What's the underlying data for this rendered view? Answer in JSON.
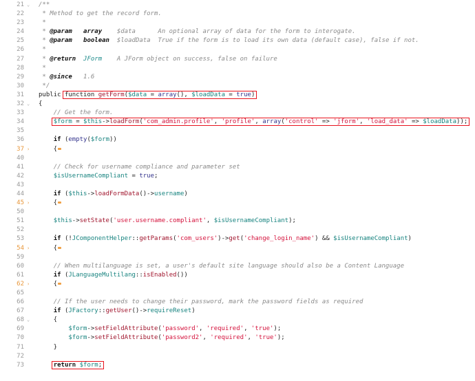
{
  "watermark": "FREEBUF",
  "colors": {
    "highlight_box": "#e8121c",
    "collapsed_fold": "#e8973a",
    "variable": "#17837f",
    "function": "#a0142c",
    "string": "#d4113b",
    "builtin": "#33338c",
    "comment": "#8a8a8a"
  },
  "lines": [
    {
      "n": "21",
      "fold": "open",
      "t": [
        [
          "c",
          "/**"
        ]
      ]
    },
    {
      "n": "22",
      "t": [
        [
          "c",
          " * Method to get the record form."
        ]
      ]
    },
    {
      "n": "23",
      "t": [
        [
          "c",
          " *"
        ]
      ]
    },
    {
      "n": "24",
      "t": [
        [
          "c",
          " * "
        ],
        [
          "t",
          "@param"
        ],
        [
          "c",
          "   "
        ],
        [
          "t",
          "array"
        ],
        [
          "c",
          "    $data      An optional array of data for the form to interogate."
        ]
      ]
    },
    {
      "n": "25",
      "t": [
        [
          "c",
          " * "
        ],
        [
          "t",
          "@param"
        ],
        [
          "c",
          "   "
        ],
        [
          "t",
          "boolean"
        ],
        [
          "c",
          "  $loadData  True if the form is to load its own data (default case), false if not."
        ]
      ]
    },
    {
      "n": "26",
      "t": [
        [
          "c",
          " *"
        ]
      ]
    },
    {
      "n": "27",
      "t": [
        [
          "c",
          " * "
        ],
        [
          "t",
          "@return"
        ],
        [
          "c",
          "  "
        ],
        [
          "jf",
          "JForm"
        ],
        [
          "c",
          "    A JForm object on success, false on failure"
        ]
      ]
    },
    {
      "n": "28",
      "t": [
        [
          "c",
          " *"
        ]
      ]
    },
    {
      "n": "29",
      "t": [
        [
          "c",
          " * "
        ],
        [
          "t",
          "@since"
        ],
        [
          "c",
          "   1.6"
        ]
      ]
    },
    {
      "n": "30",
      "t": [
        [
          "c",
          " */"
        ]
      ]
    },
    {
      "n": "31",
      "box_from": 1,
      "t": [
        [
          "p",
          "public "
        ],
        [
          "p",
          "function "
        ],
        [
          "f",
          "getForm"
        ],
        [
          "p",
          "("
        ],
        [
          "v",
          "$data"
        ],
        [
          "p",
          " = "
        ],
        [
          "b",
          "array"
        ],
        [
          "p",
          "(), "
        ],
        [
          "v",
          "$loadData"
        ],
        [
          "p",
          " = "
        ],
        [
          "b",
          "true"
        ],
        [
          "p",
          ")"
        ]
      ]
    },
    {
      "n": "32",
      "fold": "open",
      "t": [
        [
          "p",
          "{"
        ]
      ]
    },
    {
      "n": "33",
      "t": [
        [
          "p",
          "    "
        ],
        [
          "c",
          "// Get the form."
        ]
      ]
    },
    {
      "n": "34",
      "box_from": 1,
      "t": [
        [
          "p",
          "    "
        ],
        [
          "v",
          "$form"
        ],
        [
          "p",
          " = "
        ],
        [
          "v",
          "$this"
        ],
        [
          "p",
          "->"
        ],
        [
          "f",
          "loadForm"
        ],
        [
          "p",
          "("
        ],
        [
          "s",
          "'com_admin.profile'"
        ],
        [
          "p",
          ", "
        ],
        [
          "s",
          "'profile'"
        ],
        [
          "p",
          ", "
        ],
        [
          "b",
          "array"
        ],
        [
          "p",
          "("
        ],
        [
          "s",
          "'control'"
        ],
        [
          "p",
          " => "
        ],
        [
          "s",
          "'jform'"
        ],
        [
          "p",
          ", "
        ],
        [
          "s",
          "'load_data'"
        ],
        [
          "p",
          " => "
        ],
        [
          "v",
          "$loadData"
        ],
        [
          "p",
          "));"
        ]
      ]
    },
    {
      "n": "35",
      "t": []
    },
    {
      "n": "36",
      "t": [
        [
          "p",
          "    "
        ],
        [
          "k",
          "if"
        ],
        [
          "p",
          " ("
        ],
        [
          "b",
          "empty"
        ],
        [
          "p",
          "("
        ],
        [
          "v",
          "$form"
        ],
        [
          "p",
          "))"
        ]
      ]
    },
    {
      "n": "37",
      "fold": "closed",
      "t": [
        [
          "p",
          "    {"
        ]
      ]
    },
    {
      "n": "40",
      "t": []
    },
    {
      "n": "41",
      "t": [
        [
          "p",
          "    "
        ],
        [
          "c",
          "// Check for username compliance and parameter set"
        ]
      ]
    },
    {
      "n": "42",
      "t": [
        [
          "p",
          "    "
        ],
        [
          "v",
          "$isUsernameCompliant"
        ],
        [
          "p",
          " = "
        ],
        [
          "b",
          "true"
        ],
        [
          "p",
          ";"
        ]
      ]
    },
    {
      "n": "43",
      "t": []
    },
    {
      "n": "44",
      "t": [
        [
          "p",
          "    "
        ],
        [
          "k",
          "if"
        ],
        [
          "p",
          " ("
        ],
        [
          "v",
          "$this"
        ],
        [
          "p",
          "->"
        ],
        [
          "f",
          "loadFormData"
        ],
        [
          "p",
          "()->"
        ],
        [
          "v",
          "username"
        ],
        [
          "p",
          ")"
        ]
      ]
    },
    {
      "n": "45",
      "fold": "closed",
      "t": [
        [
          "p",
          "    {"
        ]
      ]
    },
    {
      "n": "50",
      "t": []
    },
    {
      "n": "51",
      "t": [
        [
          "p",
          "    "
        ],
        [
          "v",
          "$this"
        ],
        [
          "p",
          "->"
        ],
        [
          "f",
          "setState"
        ],
        [
          "p",
          "("
        ],
        [
          "s",
          "'user.username.compliant'"
        ],
        [
          "p",
          ", "
        ],
        [
          "v",
          "$isUsernameCompliant"
        ],
        [
          "p",
          ");"
        ]
      ]
    },
    {
      "n": "52",
      "t": []
    },
    {
      "n": "53",
      "t": [
        [
          "p",
          "    "
        ],
        [
          "k",
          "if"
        ],
        [
          "p",
          " (!"
        ],
        [
          "v",
          "JComponentHelper"
        ],
        [
          "p",
          "::"
        ],
        [
          "f",
          "getParams"
        ],
        [
          "p",
          "("
        ],
        [
          "s",
          "'com_users'"
        ],
        [
          "p",
          ")->"
        ],
        [
          "f",
          "get"
        ],
        [
          "p",
          "("
        ],
        [
          "s",
          "'change_login_name'"
        ],
        [
          "p",
          ") && "
        ],
        [
          "v",
          "$isUsernameCompliant"
        ],
        [
          "p",
          ")"
        ]
      ]
    },
    {
      "n": "54",
      "fold": "closed",
      "t": [
        [
          "p",
          "    {"
        ]
      ]
    },
    {
      "n": "59",
      "t": []
    },
    {
      "n": "60",
      "t": [
        [
          "p",
          "    "
        ],
        [
          "c",
          "// When multilanguage is set, a user's default site language should also be a Content Language"
        ]
      ]
    },
    {
      "n": "61",
      "t": [
        [
          "p",
          "    "
        ],
        [
          "k",
          "if"
        ],
        [
          "p",
          " ("
        ],
        [
          "v",
          "JLanguageMultilang"
        ],
        [
          "p",
          "::"
        ],
        [
          "f",
          "isEnabled"
        ],
        [
          "p",
          "())"
        ]
      ]
    },
    {
      "n": "62",
      "fold": "closed",
      "t": [
        [
          "p",
          "    {"
        ]
      ]
    },
    {
      "n": "65",
      "t": []
    },
    {
      "n": "66",
      "t": [
        [
          "p",
          "    "
        ],
        [
          "c",
          "// If the user needs to change their password, mark the password fields as required"
        ]
      ]
    },
    {
      "n": "67",
      "t": [
        [
          "p",
          "    "
        ],
        [
          "k",
          "if"
        ],
        [
          "p",
          " ("
        ],
        [
          "v",
          "JFactory"
        ],
        [
          "p",
          "::"
        ],
        [
          "f",
          "getUser"
        ],
        [
          "p",
          "()->"
        ],
        [
          "v",
          "requireReset"
        ],
        [
          "p",
          ")"
        ]
      ]
    },
    {
      "n": "68",
      "fold": "open",
      "t": [
        [
          "p",
          "    {"
        ]
      ]
    },
    {
      "n": "69",
      "t": [
        [
          "p",
          "        "
        ],
        [
          "v",
          "$form"
        ],
        [
          "p",
          "->"
        ],
        [
          "f",
          "setFieldAttribute"
        ],
        [
          "p",
          "("
        ],
        [
          "s",
          "'password'"
        ],
        [
          "p",
          ", "
        ],
        [
          "s",
          "'required'"
        ],
        [
          "p",
          ", "
        ],
        [
          "s",
          "'true'"
        ],
        [
          "p",
          ");"
        ]
      ]
    },
    {
      "n": "70",
      "t": [
        [
          "p",
          "        "
        ],
        [
          "v",
          "$form"
        ],
        [
          "p",
          "->"
        ],
        [
          "f",
          "setFieldAttribute"
        ],
        [
          "p",
          "("
        ],
        [
          "s",
          "'password2'"
        ],
        [
          "p",
          ", "
        ],
        [
          "s",
          "'required'"
        ],
        [
          "p",
          ", "
        ],
        [
          "s",
          "'true'"
        ],
        [
          "p",
          ");"
        ]
      ]
    },
    {
      "n": "71",
      "t": [
        [
          "p",
          "    }"
        ]
      ]
    },
    {
      "n": "72",
      "t": []
    },
    {
      "n": "73",
      "box_from": 1,
      "t": [
        [
          "p",
          "    "
        ],
        [
          "k",
          "return"
        ],
        [
          "p",
          " "
        ],
        [
          "v",
          "$form"
        ],
        [
          "p",
          ";"
        ]
      ]
    }
  ]
}
